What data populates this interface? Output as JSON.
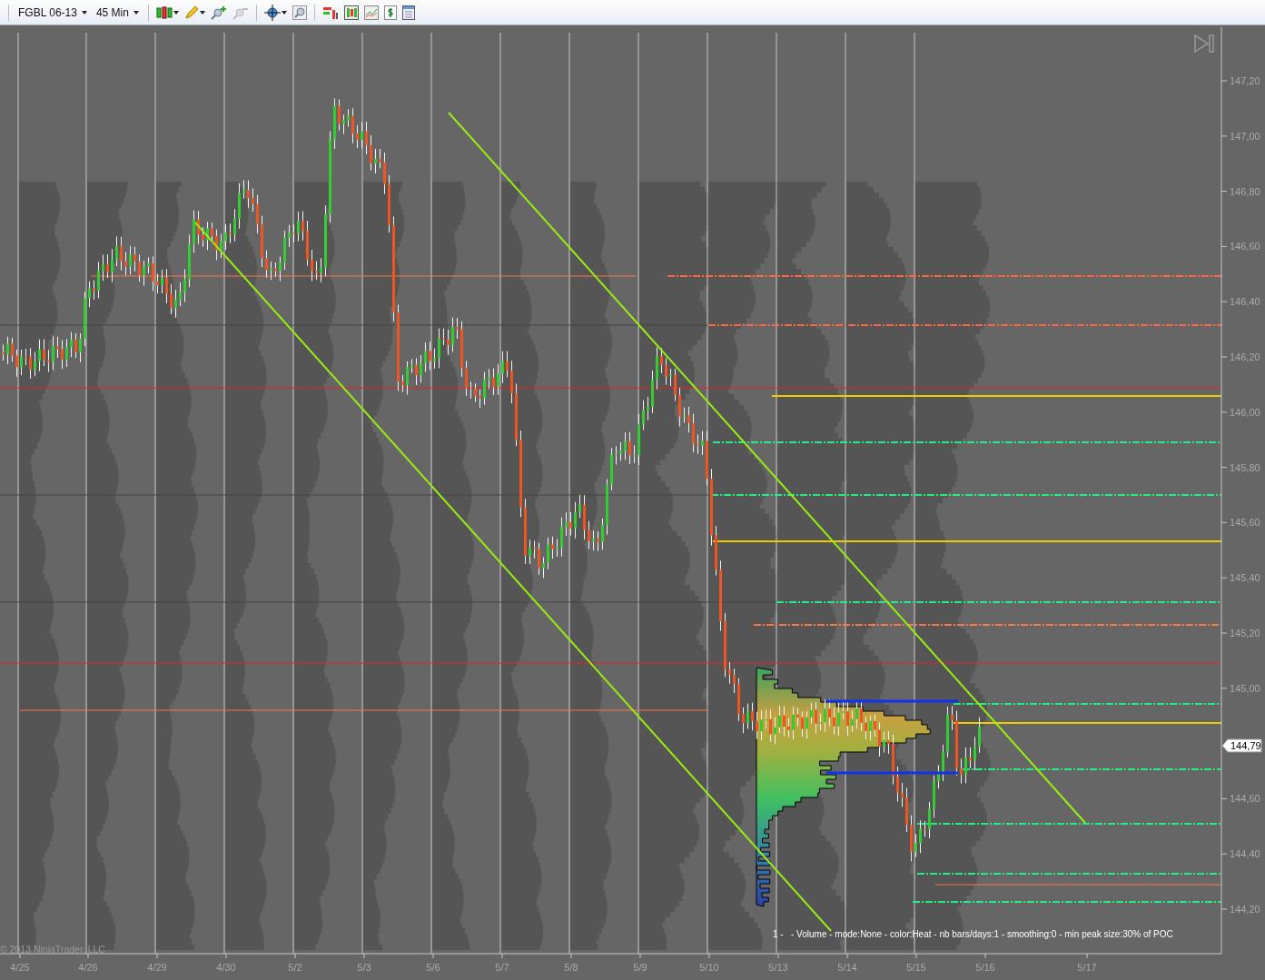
{
  "toolbar": {
    "instrument": "FGBL 06-13",
    "interval": "45 Min"
  },
  "chart": {
    "price_axis": [
      "147,20",
      "147,00",
      "146,80",
      "146,60",
      "146,40",
      "146,20",
      "146,00",
      "145,80",
      "145,60",
      "145,40",
      "145,20",
      "145,00",
      "144,60",
      "144,40",
      "144,20"
    ],
    "time_axis": [
      "4/25",
      "4/26",
      "4/29",
      "4/30",
      "5/2",
      "5/3",
      "5/6",
      "5/7",
      "5/8",
      "5/9",
      "5/10",
      "5/13",
      "5/14",
      "5/15",
      "5/16",
      "5/17"
    ],
    "last_price": "144,79",
    "indicator_label": "1 -   - Volume - mode:None - color:Heat - nb bars/days:1 - smoothing:0 - min peak size:30% of POC",
    "copyright": "© 2013 NinjaTrader, LLC"
  }
}
